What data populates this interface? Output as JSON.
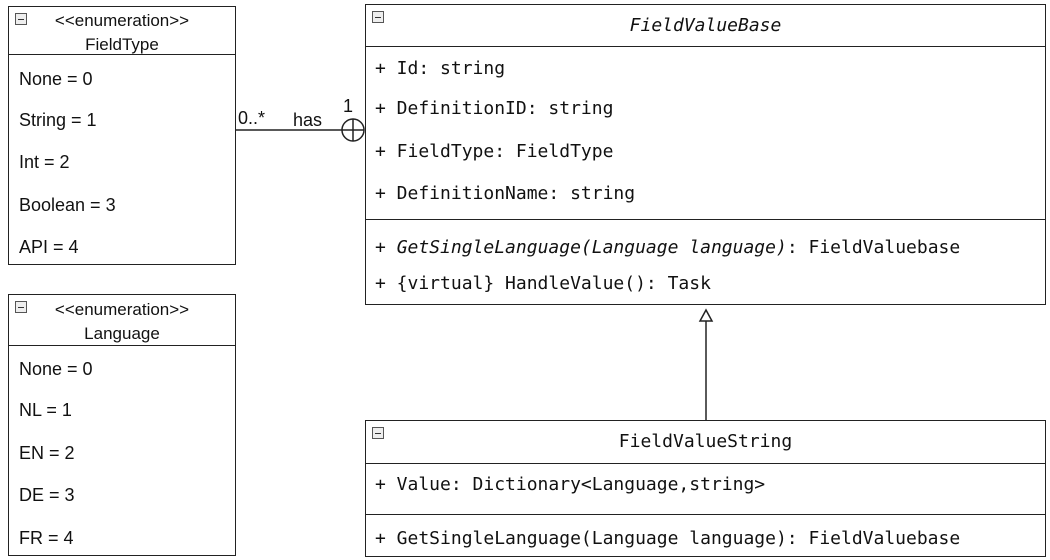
{
  "field_type_enum": {
    "stereotype": "<<enumeration>>",
    "name": "FieldType",
    "literals": [
      "None = 0",
      "String = 1",
      "Int = 2",
      "Boolean = 3",
      "API = 4"
    ]
  },
  "language_enum": {
    "stereotype": "<<enumeration>>",
    "name": "Language",
    "literals": [
      "None = 0",
      "NL = 1",
      "EN = 2",
      "DE = 3",
      "FR = 4"
    ]
  },
  "field_value_base": {
    "name": "FieldValueBase",
    "attributes": [
      "+ Id: string",
      "+ DefinitionID: string",
      "+ FieldType: FieldType",
      "+ DefinitionName: string"
    ],
    "operations": [
      {
        "prefix": "+ ",
        "signature": "GetSingleLanguage(Language language)",
        "suffix": ": FieldValuebase"
      },
      {
        "prefix": "",
        "signature": "+ {virtual} HandleValue(): Task",
        "suffix": ""
      }
    ]
  },
  "field_value_string": {
    "name": "FieldValueString",
    "attributes": [
      "+ Value: Dictionary<Language,string>"
    ],
    "operations": [
      "+ GetSingleLanguage(Language language): FieldValuebase"
    ]
  },
  "association": {
    "source_multiplicity": "0..*",
    "role": "has",
    "target_multiplicity": "1"
  }
}
